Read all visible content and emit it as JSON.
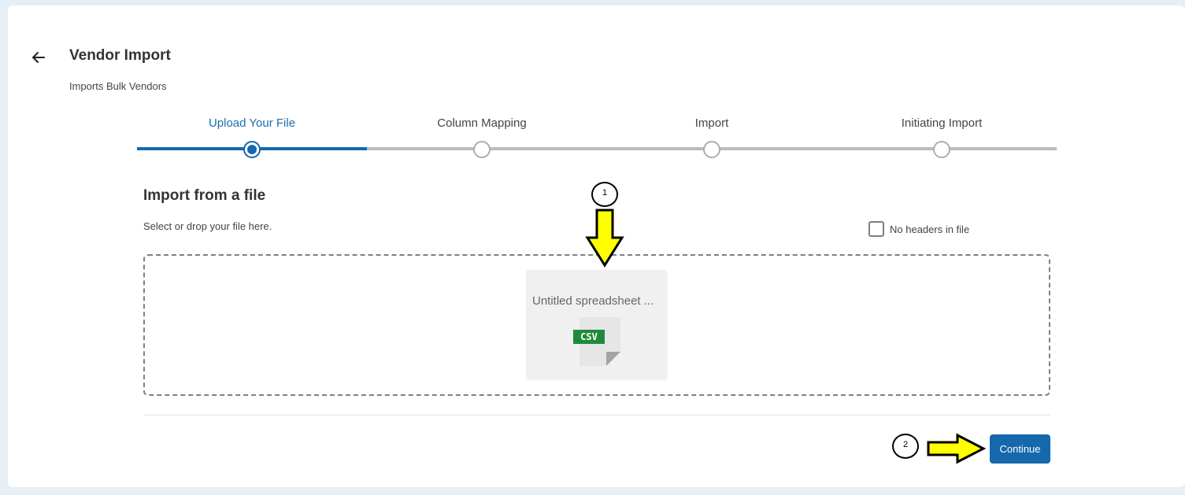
{
  "page": {
    "title": "Vendor Import",
    "subtitle": "Imports Bulk Vendors"
  },
  "stepper": {
    "steps": [
      {
        "label": "Upload Your File",
        "active": true
      },
      {
        "label": "Column Mapping",
        "active": false
      },
      {
        "label": "Import",
        "active": false
      },
      {
        "label": "Initiating Import",
        "active": false
      }
    ],
    "progress_fraction": 0.25
  },
  "upload": {
    "section_title": "Import from a file",
    "hint": "Select or drop your file here.",
    "no_headers_label": "No headers in file",
    "no_headers_checked": false,
    "file_name": "Untitled spreadsheet ...",
    "file_type_badge": "CSV"
  },
  "footer": {
    "continue_label": "Continue"
  },
  "annotations": {
    "callout_1": "1",
    "callout_2": "2",
    "arrow_color": "#ffff00"
  },
  "colors": {
    "accent": "#1668ad",
    "csv_badge": "#1f8a3d",
    "background": "#e6eef6"
  }
}
